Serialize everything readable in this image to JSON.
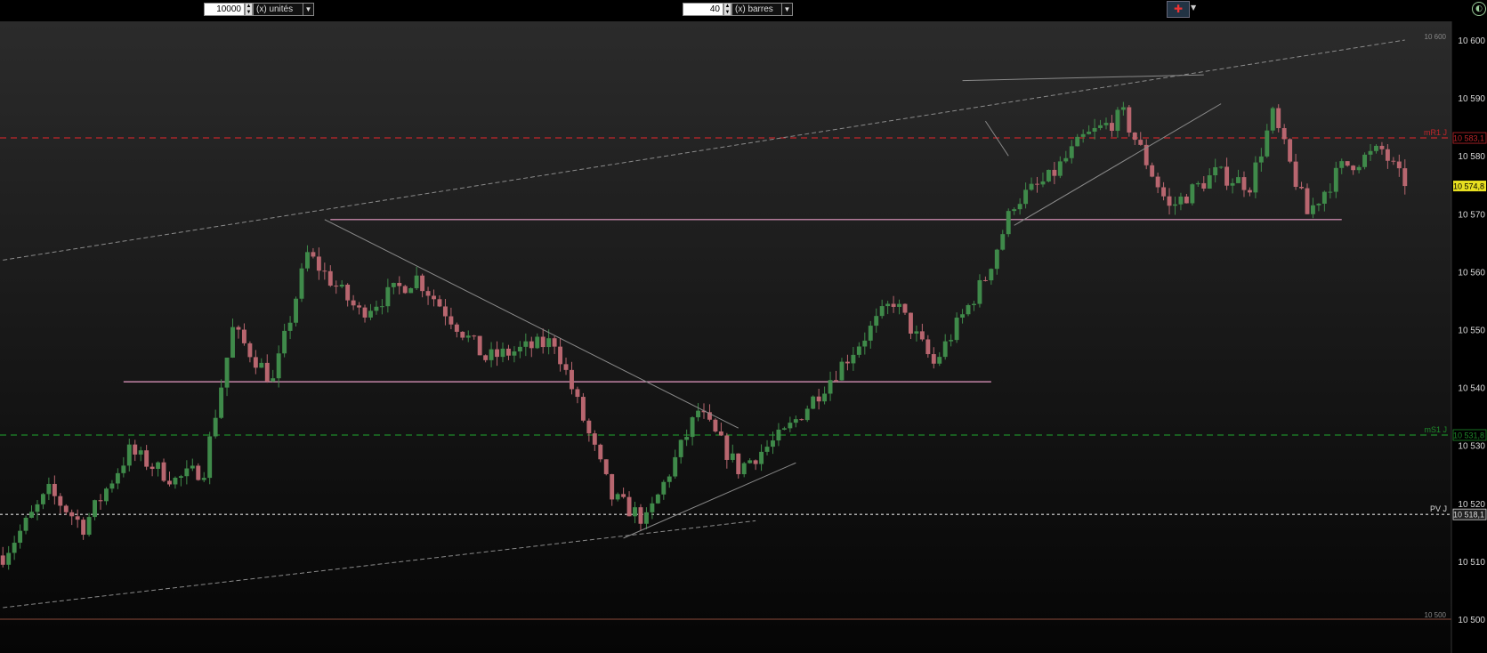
{
  "toolbar": {
    "units_value": "10000",
    "units_label": "(x) unités",
    "bars_value": "40",
    "bars_label": "(x) barres"
  },
  "colors": {
    "background_top": "#2b2b2b",
    "background_bottom": "#050505",
    "candle_up": "#3f8a4a",
    "candle_down": "#b8666f",
    "support_line": "#e69bc4",
    "trend_line": "#8a8a8a",
    "r1_line": "#c0262b",
    "s1_line": "#1e8a2a",
    "pivot_line": "#dddddd",
    "last_price_bg": "#e8e020"
  },
  "chart_data": {
    "type": "candlestick",
    "ylim": [
      10500,
      10602
    ],
    "y_ticks": [
      {
        "value": 10600,
        "label": "10 600"
      },
      {
        "value": 10590,
        "label": "10 590"
      },
      {
        "value": 10580,
        "label": "10 580"
      },
      {
        "value": 10570,
        "label": "10 570"
      },
      {
        "value": 10560,
        "label": "10 560"
      },
      {
        "value": 10550,
        "label": "10 550"
      },
      {
        "value": 10540,
        "label": "10 540"
      },
      {
        "value": 10530,
        "label": "10 530"
      },
      {
        "value": 10520,
        "label": "10 520"
      },
      {
        "value": 10510,
        "label": "10 510"
      },
      {
        "value": 10500,
        "label": "10 500"
      }
    ],
    "corner_labels": {
      "top": "10 600",
      "bottom": "10 500"
    },
    "levels": [
      {
        "name": "mR1 J",
        "value": 10583.1,
        "price_label": "10 583,1",
        "style": "dashed",
        "color": "r1_line"
      },
      {
        "name": "mS1 J",
        "value": 10531.8,
        "price_label": "10 531,8",
        "style": "dashed",
        "color": "s1_line"
      },
      {
        "name": "PV J",
        "value": 10518.1,
        "price_label": "10 518,1",
        "style": "dotted",
        "color": "pivot_line"
      }
    ],
    "last_price": {
      "value": 10574.8,
      "label": "10 574,8"
    },
    "n_bars": 245,
    "price_path": [
      [
        0,
        10511
      ],
      [
        8,
        10522
      ],
      [
        14,
        10516
      ],
      [
        22,
        10529
      ],
      [
        30,
        10524
      ],
      [
        35,
        10526
      ],
      [
        40,
        10550
      ],
      [
        47,
        10541
      ],
      [
        53,
        10563
      ],
      [
        62,
        10553
      ],
      [
        72,
        10559
      ],
      [
        84,
        10545
      ],
      [
        96,
        10548
      ],
      [
        106,
        10521
      ],
      [
        112,
        10517
      ],
      [
        121,
        10536
      ],
      [
        128,
        10526
      ],
      [
        136,
        10532
      ],
      [
        146,
        10544
      ],
      [
        155,
        10555
      ],
      [
        162,
        10544
      ],
      [
        171,
        10559
      ],
      [
        176,
        10572
      ],
      [
        182,
        10576
      ],
      [
        188,
        10583
      ],
      [
        195,
        10587
      ],
      [
        203,
        10571
      ],
      [
        211,
        10577
      ],
      [
        217,
        10575
      ],
      [
        221,
        10587
      ],
      [
        227,
        10570
      ],
      [
        233,
        10578
      ],
      [
        240,
        10581
      ],
      [
        244,
        10574.8
      ]
    ],
    "horizontal_segments": [
      {
        "value": 10569,
        "x_from": 57,
        "x_to": 233,
        "color": "support_line"
      },
      {
        "value": 10541,
        "x_from": 21,
        "x_to": 172,
        "color": "support_line"
      }
    ],
    "trend_lines": [
      {
        "from": [
          0,
          10562
        ],
        "to": [
          244,
          10600
        ]
      },
      {
        "from": [
          0,
          10502
        ],
        "to": [
          131,
          10517
        ]
      },
      {
        "from": [
          56,
          10569
        ],
        "to": [
          128,
          10533
        ]
      },
      {
        "from": [
          108,
          10514
        ],
        "to": [
          138,
          10527
        ]
      },
      {
        "from": [
          167,
          10593
        ],
        "to": [
          209,
          10594
        ]
      },
      {
        "from": [
          175,
          10580
        ],
        "to": [
          171,
          10586
        ]
      },
      {
        "from": [
          176,
          10568
        ],
        "to": [
          212,
          10589
        ]
      }
    ]
  }
}
